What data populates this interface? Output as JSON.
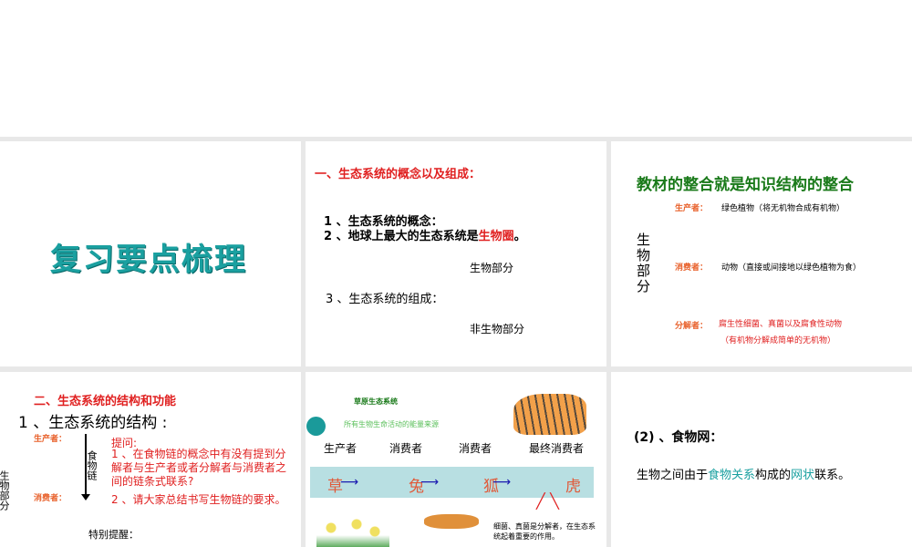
{
  "slide1": {
    "title": "复习要点梳理"
  },
  "slide2": {
    "heading": "一、生态系统的概念以及组成：",
    "item1": "1 、生态系统的概念：",
    "item2_prefix": "2 、地球上最大的生态系统是",
    "item2_highlight": "生物圈",
    "item2_suffix": "。",
    "bio": "生物部分",
    "item3": "3 、生态系统的组成：",
    "nonbio": "非生物部分"
  },
  "slide3": {
    "title": "教材的整合就是知识结构的整合",
    "bio_part": "生物部分",
    "producer_label": "生产者：",
    "producer_text": "绿色植物（将无机物合成有机物）",
    "consumer_label": "消费者：",
    "consumer_text": "动物（直接或间接地以绿色植物为食）",
    "decomposer_label": "分解者：",
    "decomposer_text": "腐生性细菌、真菌以及腐食性动物",
    "decomposer_note": "（有机物分解成简单的无机物）"
  },
  "slide4": {
    "heading": "二、生态系统的结构和功能",
    "sub": "1 、生态系统的结构 :",
    "producer": "生产者：",
    "consumer": "消费者：",
    "food_chain": "食物链",
    "bio_part": "生物部分",
    "q_title": "提问:",
    "q1": "1 、在食物链的概念中有没有提到分解者与生产者或者分解者与消费者之间的链条式联系?",
    "q2": "2 、请大家总结书写生物链的要求。",
    "reminder": "特别提醒："
  },
  "slide5": {
    "title": "草原生态系统",
    "sun_note": "所有生物生命活动的能量来源",
    "roles": [
      "生产者",
      "消费者",
      "消费者",
      "最终消费者"
    ],
    "chain": [
      "草",
      "兔",
      "狐",
      "虎"
    ],
    "decomposer_note": "细菌、真菌是分解者，在生态系统起着重要的作用。"
  },
  "slide6": {
    "heading": "(2) 、食物网：",
    "text_prefix": "生物之间由于",
    "hl1": "食物关系",
    "text_mid": "构成的",
    "hl2": "网状",
    "text_suffix": "联系。"
  }
}
